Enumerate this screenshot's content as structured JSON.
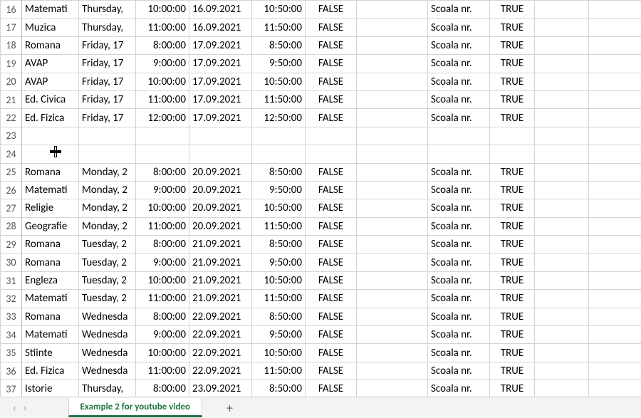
{
  "tab_name": "Example 2 for youtube video",
  "rows": [
    {
      "n": 16,
      "a": "Matemati",
      "b": "Thursday,",
      "c": "10:00:00",
      "d": "16.09.2021",
      "e": "10:50:00",
      "f": "FALSE",
      "h": "Scoala nr.",
      "i": "TRUE"
    },
    {
      "n": 17,
      "a": "Muzica",
      "b": "Thursday,",
      "c": "11:00:00",
      "d": "16.09.2021",
      "e": "11:50:00",
      "f": "FALSE",
      "h": "Scoala nr.",
      "i": "TRUE"
    },
    {
      "n": 18,
      "a": "Romana",
      "b": "Friday, 17",
      "c": "8:00:00",
      "d": "17.09.2021",
      "e": "8:50:00",
      "f": "FALSE",
      "h": "Scoala nr.",
      "i": "TRUE"
    },
    {
      "n": 19,
      "a": "AVAP",
      "b": "Friday, 17",
      "c": "9:00:00",
      "d": "17.09.2021",
      "e": "9:50:00",
      "f": "FALSE",
      "h": "Scoala nr.",
      "i": "TRUE"
    },
    {
      "n": 20,
      "a": "AVAP",
      "b": "Friday, 17",
      "c": "10:00:00",
      "d": "17.09.2021",
      "e": "10:50:00",
      "f": "FALSE",
      "h": "Scoala nr.",
      "i": "TRUE"
    },
    {
      "n": 21,
      "a": "Ed. Civica",
      "b": "Friday, 17",
      "c": "11:00:00",
      "d": "17.09.2021",
      "e": "11:50:00",
      "f": "FALSE",
      "h": "Scoala nr.",
      "i": "TRUE"
    },
    {
      "n": 22,
      "a": "Ed. Fizica",
      "b": "Friday, 17",
      "c": "12:00:00",
      "d": "17.09.2021",
      "e": "12:50:00",
      "f": "FALSE",
      "h": "Scoala nr.",
      "i": "TRUE"
    },
    {
      "n": 23,
      "a": "",
      "b": "",
      "c": "",
      "d": "",
      "e": "",
      "f": "",
      "h": "",
      "i": ""
    },
    {
      "n": 24,
      "a": "",
      "b": "",
      "c": "",
      "d": "",
      "e": "",
      "f": "",
      "h": "",
      "i": ""
    },
    {
      "n": 25,
      "a": "Romana",
      "b": "Monday, 2",
      "c": "8:00:00",
      "d": "20.09.2021",
      "e": "8:50:00",
      "f": "FALSE",
      "h": "Scoala nr.",
      "i": "TRUE"
    },
    {
      "n": 26,
      "a": "Matemati",
      "b": "Monday, 2",
      "c": "9:00:00",
      "d": "20.09.2021",
      "e": "9:50:00",
      "f": "FALSE",
      "h": "Scoala nr.",
      "i": "TRUE"
    },
    {
      "n": 27,
      "a": "Religie",
      "b": "Monday, 2",
      "c": "10:00:00",
      "d": "20.09.2021",
      "e": "10:50:00",
      "f": "FALSE",
      "h": "Scoala nr.",
      "i": "TRUE"
    },
    {
      "n": 28,
      "a": "Geografie",
      "b": "Monday, 2",
      "c": "11:00:00",
      "d": "20.09.2021",
      "e": "11:50:00",
      "f": "FALSE",
      "h": "Scoala nr.",
      "i": "TRUE"
    },
    {
      "n": 29,
      "a": "Romana",
      "b": "Tuesday, 2",
      "c": "8:00:00",
      "d": "21.09.2021",
      "e": "8:50:00",
      "f": "FALSE",
      "h": "Scoala nr.",
      "i": "TRUE"
    },
    {
      "n": 30,
      "a": "Romana",
      "b": "Tuesday, 2",
      "c": "9:00:00",
      "d": "21.09.2021",
      "e": "9:50:00",
      "f": "FALSE",
      "h": "Scoala nr.",
      "i": "TRUE"
    },
    {
      "n": 31,
      "a": "Engleza",
      "b": "Tuesday, 2",
      "c": "10:00:00",
      "d": "21.09.2021",
      "e": "10:50:00",
      "f": "FALSE",
      "h": "Scoala nr.",
      "i": "TRUE"
    },
    {
      "n": 32,
      "a": "Matemati",
      "b": "Tuesday, 2",
      "c": "11:00:00",
      "d": "21.09.2021",
      "e": "11:50:00",
      "f": "FALSE",
      "h": "Scoala nr.",
      "i": "TRUE"
    },
    {
      "n": 33,
      "a": "Romana",
      "b": "Wednesda",
      "c": "8:00:00",
      "d": "22.09.2021",
      "e": "8:50:00",
      "f": "FALSE",
      "h": "Scoala nr.",
      "i": "TRUE"
    },
    {
      "n": 34,
      "a": "Matemati",
      "b": "Wednesda",
      "c": "9:00:00",
      "d": "22.09.2021",
      "e": "9:50:00",
      "f": "FALSE",
      "h": "Scoala nr.",
      "i": "TRUE"
    },
    {
      "n": 35,
      "a": "Stiinte",
      "b": "Wednesda",
      "c": "10:00:00",
      "d": "22.09.2021",
      "e": "10:50:00",
      "f": "FALSE",
      "h": "Scoala nr.",
      "i": "TRUE"
    },
    {
      "n": 36,
      "a": "Ed. Fizica",
      "b": "Wednesda",
      "c": "11:00:00",
      "d": "22.09.2021",
      "e": "11:50:00",
      "f": "FALSE",
      "h": "Scoala nr.",
      "i": "TRUE"
    },
    {
      "n": 37,
      "a": "Istorie",
      "b": "Thursday,",
      "c": "8:00:00",
      "d": "23.09.2021",
      "e": "8:50:00",
      "f": "FALSE",
      "h": "Scoala nr.",
      "i": "TRUE"
    }
  ],
  "nav": {
    "prev": "‹",
    "next": "›",
    "add": "+"
  }
}
